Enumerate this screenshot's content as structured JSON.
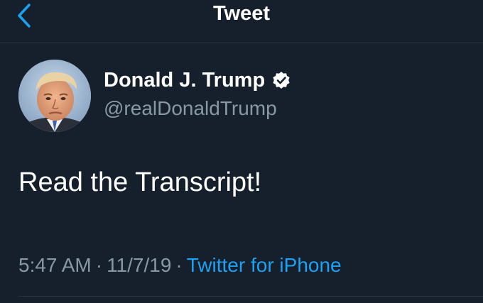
{
  "header": {
    "title": "Tweet",
    "back_icon": "chevron-left-icon",
    "accent_color": "#1da1f2"
  },
  "tweet": {
    "author": {
      "display_name": "Donald J. Trump",
      "handle": "@realDonaldTrump",
      "verified": true,
      "verified_icon": "verified-badge-icon"
    },
    "text": "Read the Transcript!",
    "time": "5:47 AM",
    "date": "11/7/19",
    "separator": "·",
    "source": "Twitter for iPhone"
  },
  "colors": {
    "background": "#16202c",
    "secondary_text": "#8899a6",
    "link": "#1da1f2"
  }
}
